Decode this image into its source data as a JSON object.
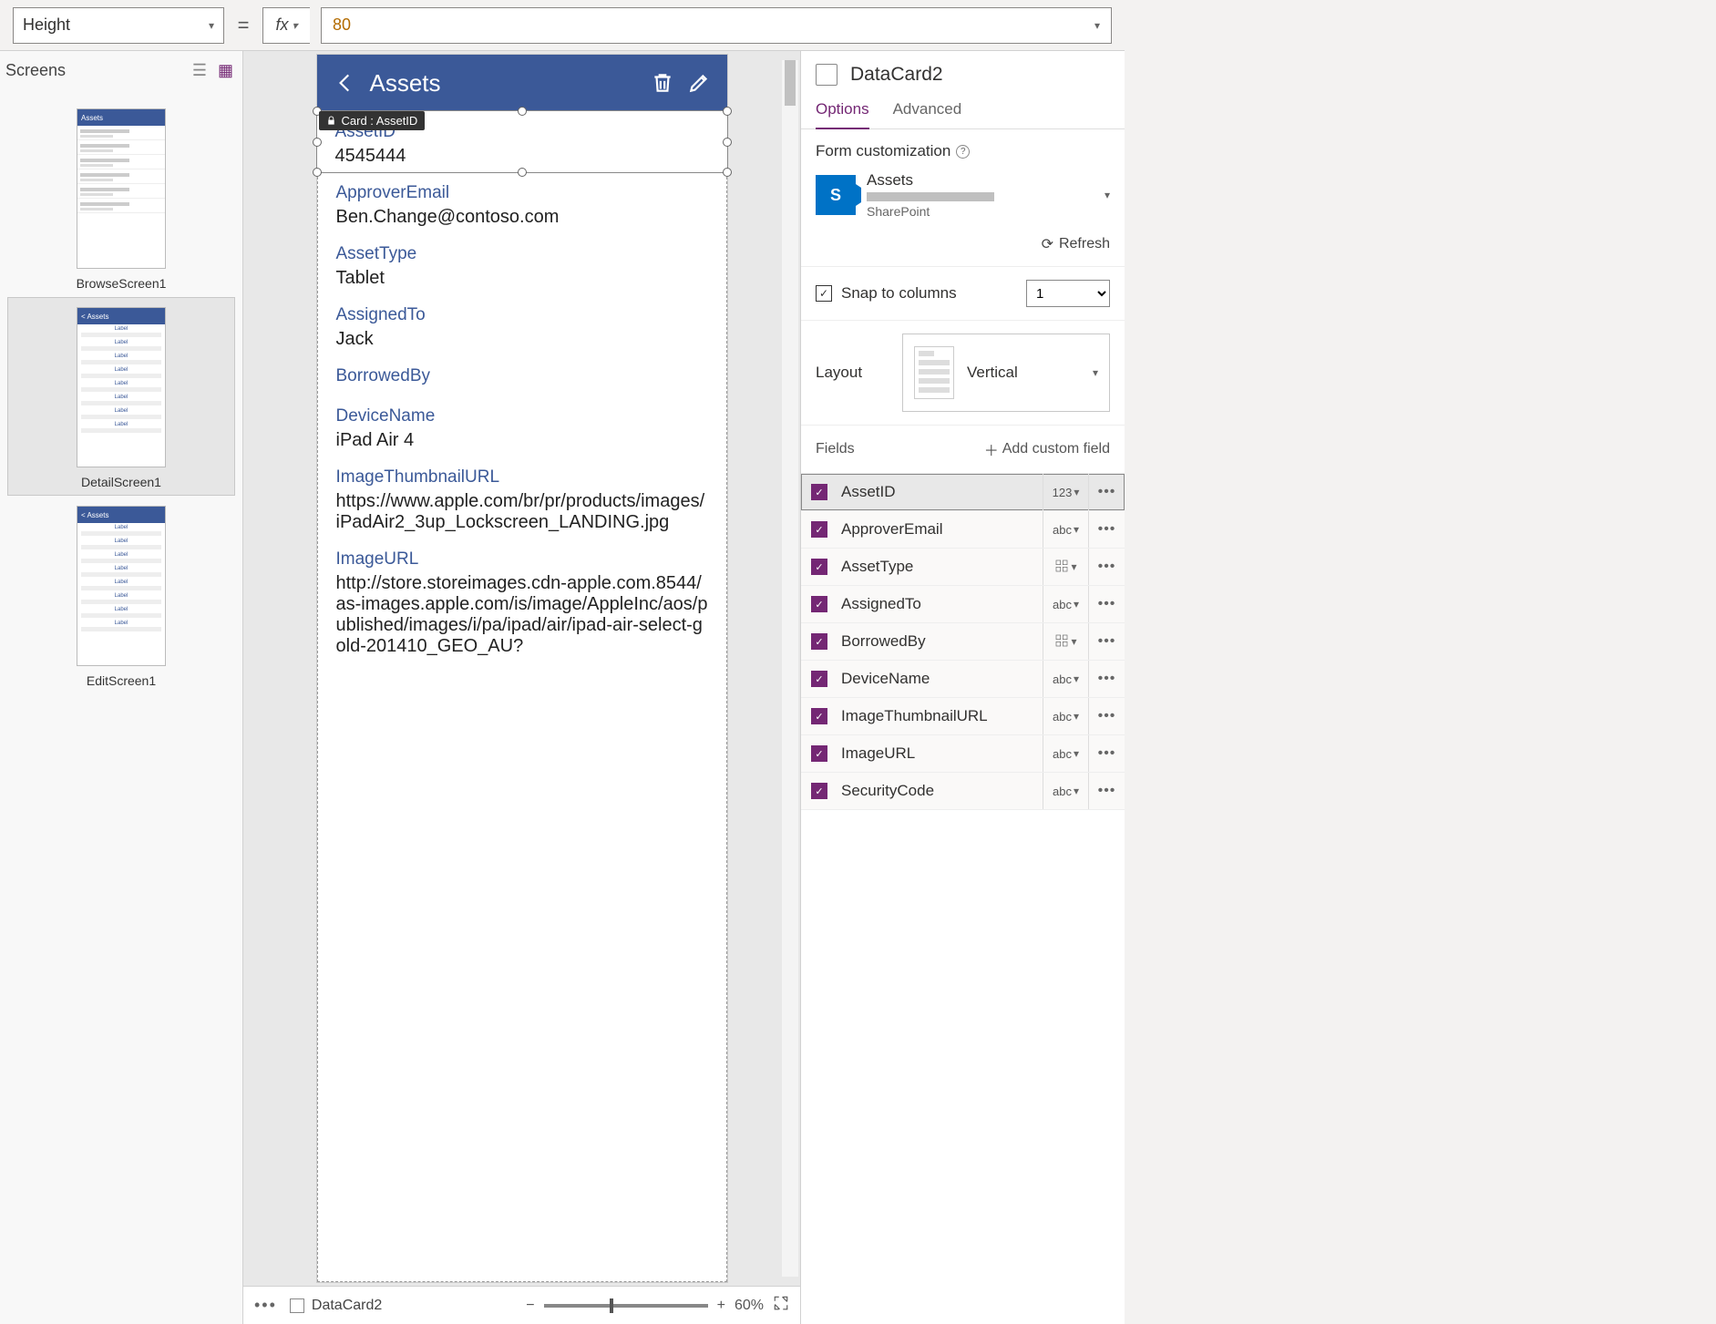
{
  "formula_bar": {
    "property": "Height",
    "fx_label": "fx",
    "value": "80"
  },
  "screens_panel": {
    "title": "Screens",
    "thumbs": [
      {
        "name": "BrowseScreen1",
        "title": "Assets"
      },
      {
        "name": "DetailScreen1",
        "title": "Assets"
      },
      {
        "name": "EditScreen1",
        "title": "Assets"
      }
    ]
  },
  "canvas": {
    "header_title": "Assets",
    "tooltip": "Card : AssetID",
    "cards": [
      {
        "label": "AssetID",
        "value": "4545444"
      },
      {
        "label": "ApproverEmail",
        "value": "Ben.Change@contoso.com"
      },
      {
        "label": "AssetType",
        "value": "Tablet"
      },
      {
        "label": "AssignedTo",
        "value": "Jack"
      },
      {
        "label": "BorrowedBy",
        "value": ""
      },
      {
        "label": "DeviceName",
        "value": "iPad Air 4"
      },
      {
        "label": "ImageThumbnailURL",
        "value": "https://www.apple.com/br/pr/products/images/iPadAir2_3up_Lockscreen_LANDING.jpg"
      },
      {
        "label": "ImageURL",
        "value": "http://store.storeimages.cdn-apple.com.8544/as-images.apple.com/is/image/AppleInc/aos/published/images/i/pa/ipad/air/ipad-air-select-gold-201410_GEO_AU?"
      }
    ]
  },
  "bottom": {
    "crumb": "DataCard2",
    "zoom": "60%"
  },
  "right": {
    "title": "DataCard2",
    "tabs": {
      "options": "Options",
      "advanced": "Advanced"
    },
    "form_custom": "Form customization",
    "datasource": {
      "name": "Assets",
      "type": "SharePoint"
    },
    "refresh": "Refresh",
    "snap_label": "Snap to columns",
    "snap_value": "1",
    "layout_label": "Layout",
    "layout_value": "Vertical",
    "fields_label": "Fields",
    "add_field": "Add custom field",
    "fields": [
      {
        "name": "AssetID",
        "type": "123",
        "selected": true
      },
      {
        "name": "ApproverEmail",
        "type": "abc"
      },
      {
        "name": "AssetType",
        "type": "grid"
      },
      {
        "name": "AssignedTo",
        "type": "abc"
      },
      {
        "name": "BorrowedBy",
        "type": "grid"
      },
      {
        "name": "DeviceName",
        "type": "abc"
      },
      {
        "name": "ImageThumbnailURL",
        "type": "abc"
      },
      {
        "name": "ImageURL",
        "type": "abc"
      },
      {
        "name": "SecurityCode",
        "type": "abc"
      }
    ]
  }
}
